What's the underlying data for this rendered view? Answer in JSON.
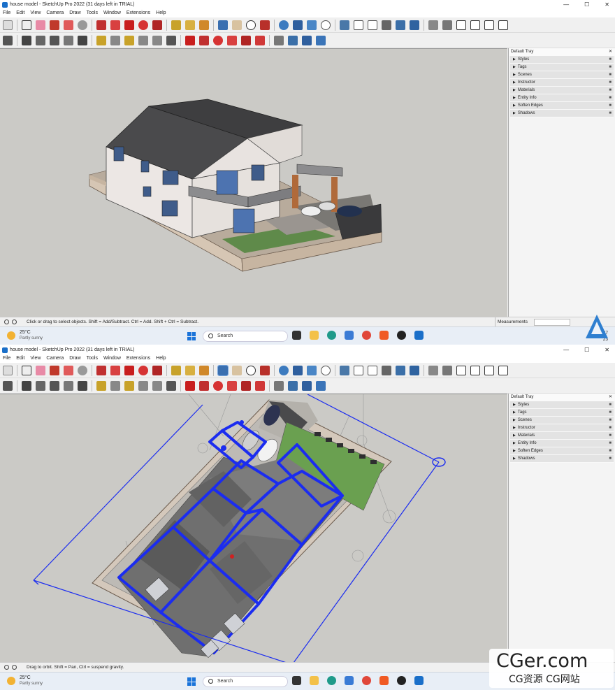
{
  "window": {
    "title": "house model - SketchUp Pro 2022 (31 days left in TRIAL)",
    "controls": [
      "—",
      "☐",
      "✕"
    ]
  },
  "menu": [
    "File",
    "Edit",
    "View",
    "Camera",
    "Draw",
    "Tools",
    "Window",
    "Extensions",
    "Help"
  ],
  "tray": {
    "title": "Default Tray",
    "items": [
      "Styles",
      "Tags",
      "Scenes",
      "Instructor",
      "Materials",
      "Entity Info",
      "Soften Edges",
      "Shadows"
    ]
  },
  "status": {
    "top_message": "Click or drag to select objects. Shift = Add/Subtract. Ctrl = Add. Shift + Ctrl = Subtract.",
    "bottom_message": "Drag to orbit. Shift = Pan, Ctrl = suspend gravity.",
    "measurements_label": "Measurements"
  },
  "taskbar": {
    "weather_temp": "25°C",
    "weather_desc": "Partly sunny",
    "search_placeholder": "Search",
    "clock": "14:37",
    "date_hint": "23"
  },
  "watermark": {
    "title": "CGer.com",
    "subtitle": "CG资源  CG网站"
  },
  "colors": {
    "viewport_bg": "#cbcac6",
    "selection_blue": "#1b2cf0",
    "roof": "#4a4a4c",
    "wall": "#ece7e4",
    "lawn": "#5f8a4a",
    "base": "#d6c6b4"
  }
}
